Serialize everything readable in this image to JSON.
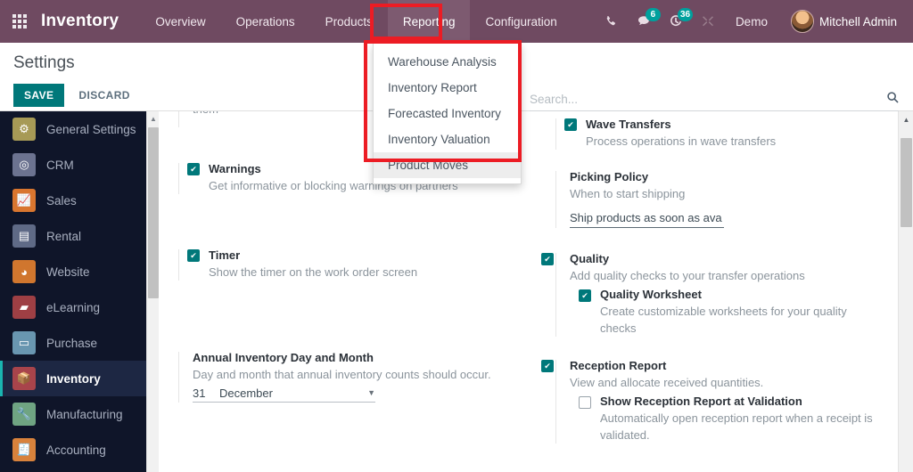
{
  "navbar": {
    "apps_icon": "apps-grid-icon",
    "brand": "Inventory",
    "menu": [
      {
        "label": "Overview",
        "active": false
      },
      {
        "label": "Operations",
        "active": false
      },
      {
        "label": "Products",
        "active": false
      },
      {
        "label": "Reporting",
        "active": true
      },
      {
        "label": "Configuration",
        "active": false
      }
    ],
    "icons": {
      "phone": "phone-icon",
      "messages": "chat-bubble-icon",
      "messages_count": "6",
      "activities": "clock-activity-icon",
      "activities_count": "36",
      "tools": "tools-icon"
    },
    "database": "Demo",
    "user_name": "Mitchell Admin",
    "avatar": "user-avatar",
    "accent_bg": "#6f4a61",
    "active_bg": "#7d5a70",
    "badge_color": "#00a09d"
  },
  "reporting_menu": {
    "items": [
      {
        "label": "Warehouse Analysis",
        "hover": false
      },
      {
        "label": "Inventory Report",
        "hover": false
      },
      {
        "label": "Forecasted Inventory",
        "hover": false
      },
      {
        "label": "Inventory Valuation",
        "hover": false
      },
      {
        "label": "Product Moves",
        "hover": true
      }
    ]
  },
  "control_panel": {
    "title": "Settings",
    "save_label": "SAVE",
    "discard_label": "DISCARD",
    "save_color": "#00787a"
  },
  "search": {
    "value": "",
    "placeholder": "Search...",
    "icon": "search-icon"
  },
  "sidebar": {
    "items": [
      {
        "label": "General Settings",
        "icon": "gear-icon",
        "color": "#a79a56",
        "selected": false
      },
      {
        "label": "CRM",
        "icon": "handshake-icon",
        "color": "#6c7390",
        "selected": false
      },
      {
        "label": "Sales",
        "icon": "chart-line-icon",
        "color": "#d9762f",
        "selected": false
      },
      {
        "label": "Rental",
        "icon": "document-icon",
        "color": "#5f6a86",
        "selected": false
      },
      {
        "label": "Website",
        "icon": "globe-icon",
        "color": "#d0762e",
        "selected": false
      },
      {
        "label": "eLearning",
        "icon": "presentation-icon",
        "color": "#9e3f44",
        "selected": false
      },
      {
        "label": "Purchase",
        "icon": "card-icon",
        "color": "#6996b0",
        "selected": false
      },
      {
        "label": "Inventory",
        "icon": "box-icon",
        "color": "#a8444b",
        "selected": true
      },
      {
        "label": "Manufacturing",
        "icon": "wrench-icon",
        "color": "#6fa482",
        "selected": false
      },
      {
        "label": "Accounting",
        "icon": "invoice-icon",
        "color": "#d8823c",
        "selected": false
      }
    ],
    "bg": "#0f1529",
    "selected_bg": "#1d2743",
    "accent": "#1ab5b0"
  },
  "settings": {
    "left_column": [
      {
        "id": "clipped-top",
        "type": "clipped",
        "text": "them"
      },
      {
        "id": "warnings",
        "type": "checkbox",
        "checked": true,
        "title": "Warnings",
        "desc": "Get informative or blocking warnings on partners"
      },
      {
        "id": "timer",
        "type": "checkbox",
        "checked": true,
        "title": "Timer",
        "desc": "Show the timer on the work order screen"
      },
      {
        "id": "annual-inventory",
        "type": "date",
        "checked": false,
        "title": "Annual Inventory Day and Month",
        "desc": "Day and month that annual inventory counts should occur.",
        "day_value": "31",
        "month_value": "December",
        "caret": "▼"
      }
    ],
    "right_column": [
      {
        "id": "wave-transfers",
        "type": "checkbox",
        "checked": true,
        "title": "Wave Transfers",
        "desc": "Process operations in wave transfers"
      },
      {
        "id": "picking-policy",
        "type": "select",
        "checked": false,
        "title": "Picking Policy",
        "desc": "When to start shipping",
        "select_value": "Ship products as soon as ava"
      },
      {
        "id": "quality",
        "type": "group",
        "checked": true,
        "title": "Quality",
        "desc": "Add quality checks to your transfer operations",
        "child": {
          "id": "quality-worksheet",
          "checked": true,
          "title": "Quality Worksheet",
          "desc": "Create customizable worksheets for your quality checks"
        }
      },
      {
        "id": "reception-report",
        "type": "group",
        "checked": true,
        "title": "Reception Report",
        "desc": "View and allocate received quantities.",
        "child": {
          "id": "show-reception-report",
          "checked": false,
          "title": "Show Reception Report at Validation",
          "desc": "Automatically open reception report when a receipt is validated."
        }
      }
    ]
  },
  "scrollbars": {
    "up_arrow": "▲",
    "sidebar_thumb": "sidebar-scroll-thumb",
    "main_thumb": "main-scroll-thumb"
  },
  "annotations": {
    "highlight_color": "#ec1c24",
    "boxes": [
      "reporting-menu-highlight",
      "reporting-dropdown-highlight"
    ]
  }
}
